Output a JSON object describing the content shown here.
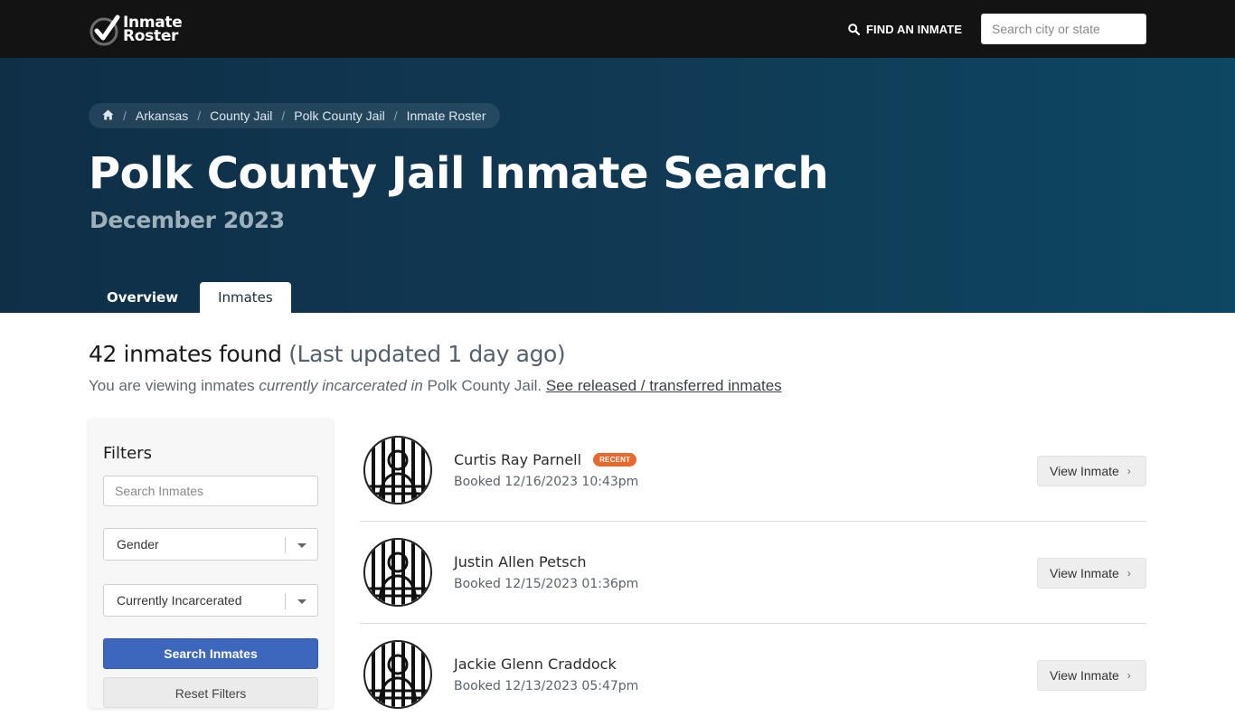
{
  "topbar": {
    "logo_line1": "Inmate",
    "logo_line2": "Roster",
    "find_label": "FIND AN INMATE",
    "search_placeholder": "Search city or state"
  },
  "breadcrumb": [
    "Arkansas",
    "County Jail",
    "Polk County Jail",
    "Inmate Roster"
  ],
  "hero": {
    "title": "Polk County Jail Inmate Search",
    "subtitle": "December 2023"
  },
  "tabs": {
    "overview": "Overview",
    "inmates": "Inmates"
  },
  "results": {
    "count": "42 inmates found",
    "updated": "(Last updated 1 day ago)",
    "viewing_pre": "You are viewing inmates ",
    "viewing_em": "currently incarcerated in",
    "viewing_post": " Polk County Jail. ",
    "released_link": "See released / transferred inmates"
  },
  "filters": {
    "title": "Filters",
    "search_placeholder": "Search Inmates",
    "gender_value": "Gender",
    "status_value": "Currently Incarcerated",
    "search_button": "Search Inmates",
    "reset_button": "Reset Filters"
  },
  "inmates": [
    {
      "name": "Curtis Ray Parnell",
      "badge": "RECENT",
      "booked": "Booked 12/16/2023 10:43pm",
      "action": "View Inmate"
    },
    {
      "name": "Justin Allen Petsch",
      "badge": "",
      "booked": "Booked 12/15/2023 01:36pm",
      "action": "View Inmate"
    },
    {
      "name": "Jackie Glenn Craddock",
      "badge": "",
      "booked": "Booked 12/13/2023 05:47pm",
      "action": "View Inmate"
    }
  ],
  "colors": {
    "topbar": "#131313",
    "hero": "#103a55",
    "primary_button": "#3c67bd",
    "recent_badge": "#e8692c"
  }
}
